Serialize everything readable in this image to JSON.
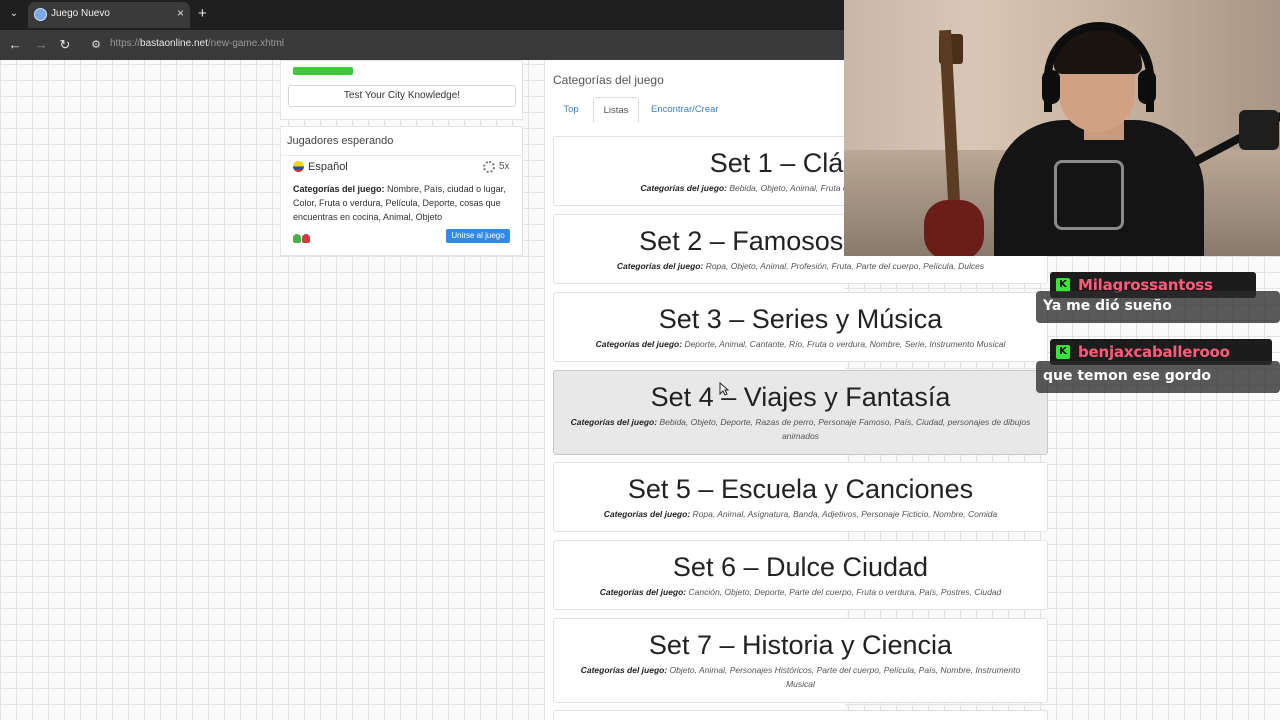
{
  "browser": {
    "tab_title": "Juego Nuevo",
    "tab_close": "×",
    "new_tab": "+",
    "menu_glyph": "⌄",
    "url_scheme": "https://",
    "url_host": "bastaonline.net",
    "url_path": "/new-game.xhtml",
    "back": "←",
    "forward": "→",
    "reload": "↻",
    "site_info": "⚙"
  },
  "left_panel": {
    "quiz_button": "Test Your City Knowledge!",
    "waiting": {
      "title": "Jugadores esperando",
      "language": "Español",
      "multiplier": "5x",
      "categories_label": "Categorías del juego:",
      "categories": "Nombre, País, ciudad o lugar, Color, Fruta o verdura, Película, Deporte, cosas que encuentras en cocina, Animal, Objeto",
      "join_button": "Unirse al juego"
    }
  },
  "categories_panel": {
    "heading": "Categorías del juego",
    "tabs": [
      {
        "label": "Top"
      },
      {
        "label": "Listas"
      },
      {
        "label": "Encontrar/Crear"
      }
    ],
    "label": "Categorías del juego:",
    "sets": [
      {
        "title": "Set 1 – Clásico",
        "categories": "Bebida, Objeto, Animal, Fruta o verdura, Nombre, País, Color"
      },
      {
        "title": "Set 2 – Famosos y Trabajo",
        "categories": "Ropa, Objeto, Animal, Profesión, Fruta, Parte del cuerpo, Película, Dulces"
      },
      {
        "title": "Set 3 – Series y Música",
        "categories": "Deporte, Animal, Cantante, Río, Fruta o verdura, Nombre, Serie, Instrumento Musical"
      },
      {
        "title": "Set 4 – Viajes y Fantasía",
        "categories": "Bebida, Objeto, Deporte, Razas de perro, Personaje Famoso, País, Ciudad, personajes de dibujos animados"
      },
      {
        "title": "Set 5 – Escuela y Canciones",
        "categories": "Ropa, Animal, Asignatura, Banda, Adjetivos, Personaje Ficticio, Nombre, Comida"
      },
      {
        "title": "Set 6 – Dulce Ciudad",
        "categories": "Canción, Objeto, Deporte, Parte del cuerpo, Fruta o verdura, País, Postres, Ciudad"
      },
      {
        "title": "Set 7 – Historia y Ciencia",
        "categories": "Objeto, Animal, Personajes Históricos, Parte del cuerpo, Película, País, Nombre, Instrumento Musical"
      }
    ]
  },
  "chat": {
    "badge": "K",
    "messages": [
      {
        "user": "Milagrossantoss",
        "text": "Ya me dió sueño"
      },
      {
        "user": "benjaxcaballerooo",
        "text": "que temon ese gordo"
      }
    ]
  },
  "colors": {
    "accent_link": "#3b82c4",
    "join_button": "#2f8be6",
    "progress_green": "#3ec736",
    "chat_username": "#ff5c7c",
    "kick_green": "#3ae23a"
  }
}
